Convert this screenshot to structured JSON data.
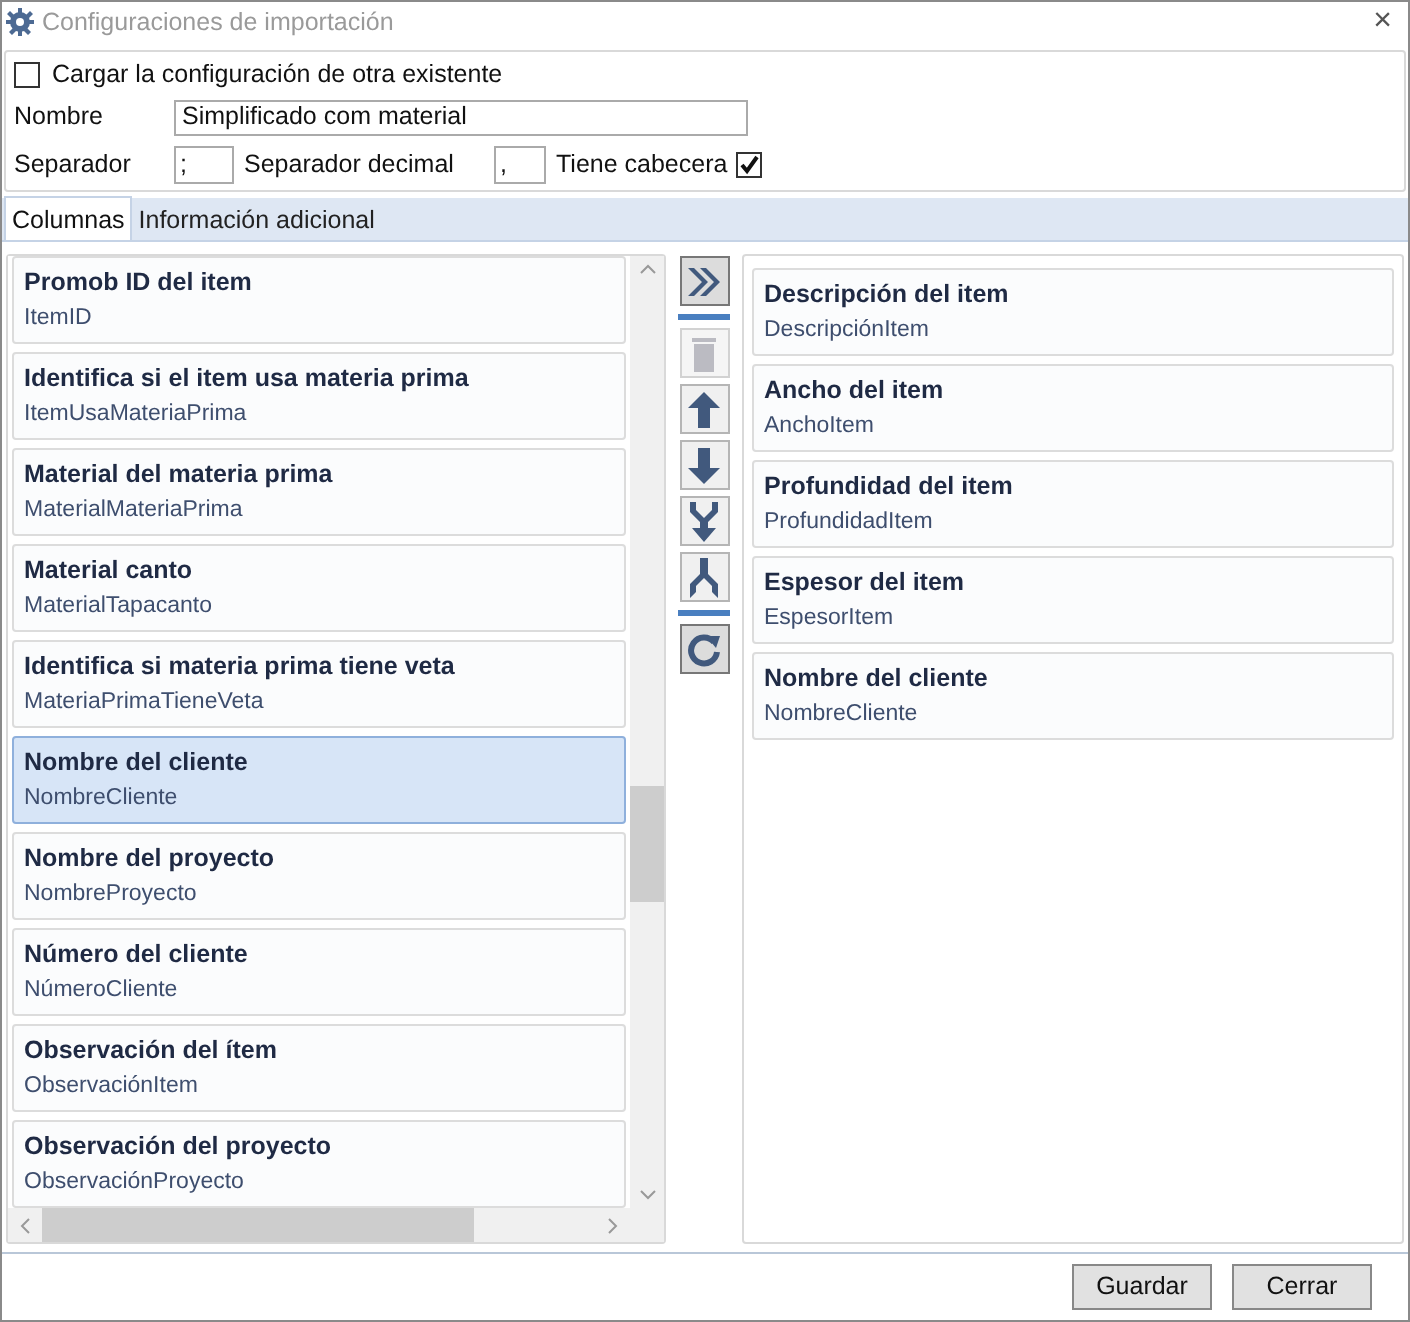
{
  "window": {
    "title": "Configuraciones de importación",
    "close": "×"
  },
  "form": {
    "load_existing": {
      "label": "Cargar la configuración de otra existente",
      "checked": false
    },
    "name": {
      "label": "Nombre",
      "value": "Simplificado com material"
    },
    "separator": {
      "label": "Separador",
      "value": ";"
    },
    "decimal_separator": {
      "label": "Separador decimal",
      "value": ","
    },
    "has_header": {
      "label": "Tiene cabecera",
      "checked": true
    }
  },
  "tabs": [
    {
      "label": "Columnas",
      "selected": true
    },
    {
      "label": "Información adicional",
      "selected": false
    }
  ],
  "available_columns": [
    {
      "title": "Promob ID del item",
      "field": "ItemID",
      "selected": false
    },
    {
      "title": "Identifica si el item usa materia prima",
      "field": "ItemUsaMateriaPrima",
      "selected": false
    },
    {
      "title": "Material del materia prima",
      "field": "MaterialMateriaPrima",
      "selected": false
    },
    {
      "title": "Material canto",
      "field": "MaterialTapacanto",
      "selected": false
    },
    {
      "title": "Identifica si materia prima tiene veta",
      "field": "MateriaPrimaTieneVeta",
      "selected": false
    },
    {
      "title": "Nombre del cliente",
      "field": "NombreCliente",
      "selected": true
    },
    {
      "title": "Nombre del proyecto",
      "field": "NombreProyecto",
      "selected": false
    },
    {
      "title": "Número del cliente",
      "field": "NúmeroCliente",
      "selected": false
    },
    {
      "title": "Observación del ítem",
      "field": "ObservaciónItem",
      "selected": false
    },
    {
      "title": "Observación del proyecto",
      "field": "ObservaciónProyecto",
      "selected": false
    }
  ],
  "actions": [
    {
      "kind": "add",
      "disabled": false
    },
    {
      "kind": "separator"
    },
    {
      "kind": "delete",
      "disabled": true
    },
    {
      "kind": "up",
      "disabled": false
    },
    {
      "kind": "down",
      "disabled": false
    },
    {
      "kind": "merge",
      "disabled": false
    },
    {
      "kind": "split",
      "disabled": false
    },
    {
      "kind": "separator"
    },
    {
      "kind": "refresh",
      "disabled": false
    }
  ],
  "selected_columns": [
    {
      "title": "Descripción del item",
      "field": "DescripciónItem"
    },
    {
      "title": "Ancho del item",
      "field": "AnchoItem"
    },
    {
      "title": "Profundidad del item",
      "field": "ProfundidadItem"
    },
    {
      "title": "Espesor del item",
      "field": "EspesorItem"
    },
    {
      "title": "Nombre del cliente",
      "field": "NombreCliente"
    }
  ],
  "buttons": [
    {
      "label": "Guardar"
    },
    {
      "label": "Cerrar"
    }
  ]
}
